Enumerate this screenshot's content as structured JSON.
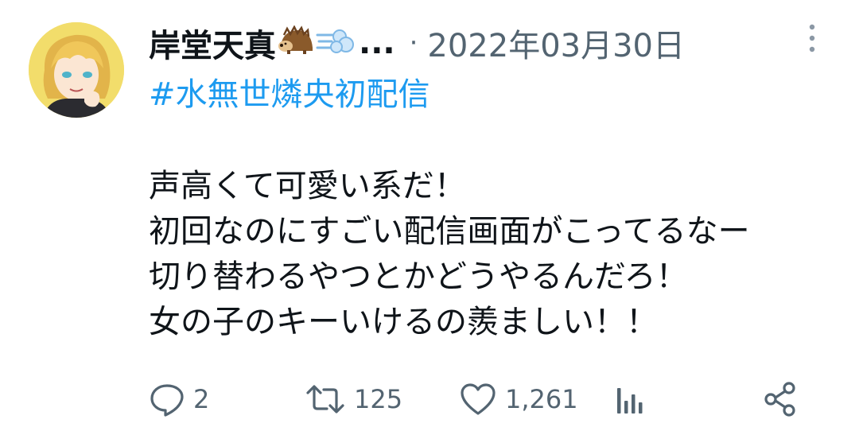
{
  "tweet": {
    "display_name": "岸堂天真",
    "name_ellipsis": "...",
    "separator": "·",
    "timestamp": "2022年03月30日",
    "hashtag": "#水無世燐央初配信",
    "body_lines": [
      "声高くて可愛い系だ！",
      "初回なのにすごい配信画面がこってるなー",
      "切り替わるやつとかどうやるんだろ！",
      "女の子のキーいけるの羨ましい！！"
    ]
  },
  "actions": {
    "reply_count": "2",
    "retweet_count": "125",
    "like_count": "1,261"
  },
  "icons": {
    "name_emojis": [
      "hedgehog-icon",
      "dash-icon"
    ],
    "more": "more-vertical-icon",
    "reply": "reply-icon",
    "retweet": "retweet-icon",
    "like": "heart-icon",
    "views": "views-icon",
    "share": "share-icon"
  },
  "colors": {
    "text": "#0f1419",
    "muted": "#536471",
    "link": "#1d9bf0",
    "avatar_bg": "#f2dd6b"
  }
}
